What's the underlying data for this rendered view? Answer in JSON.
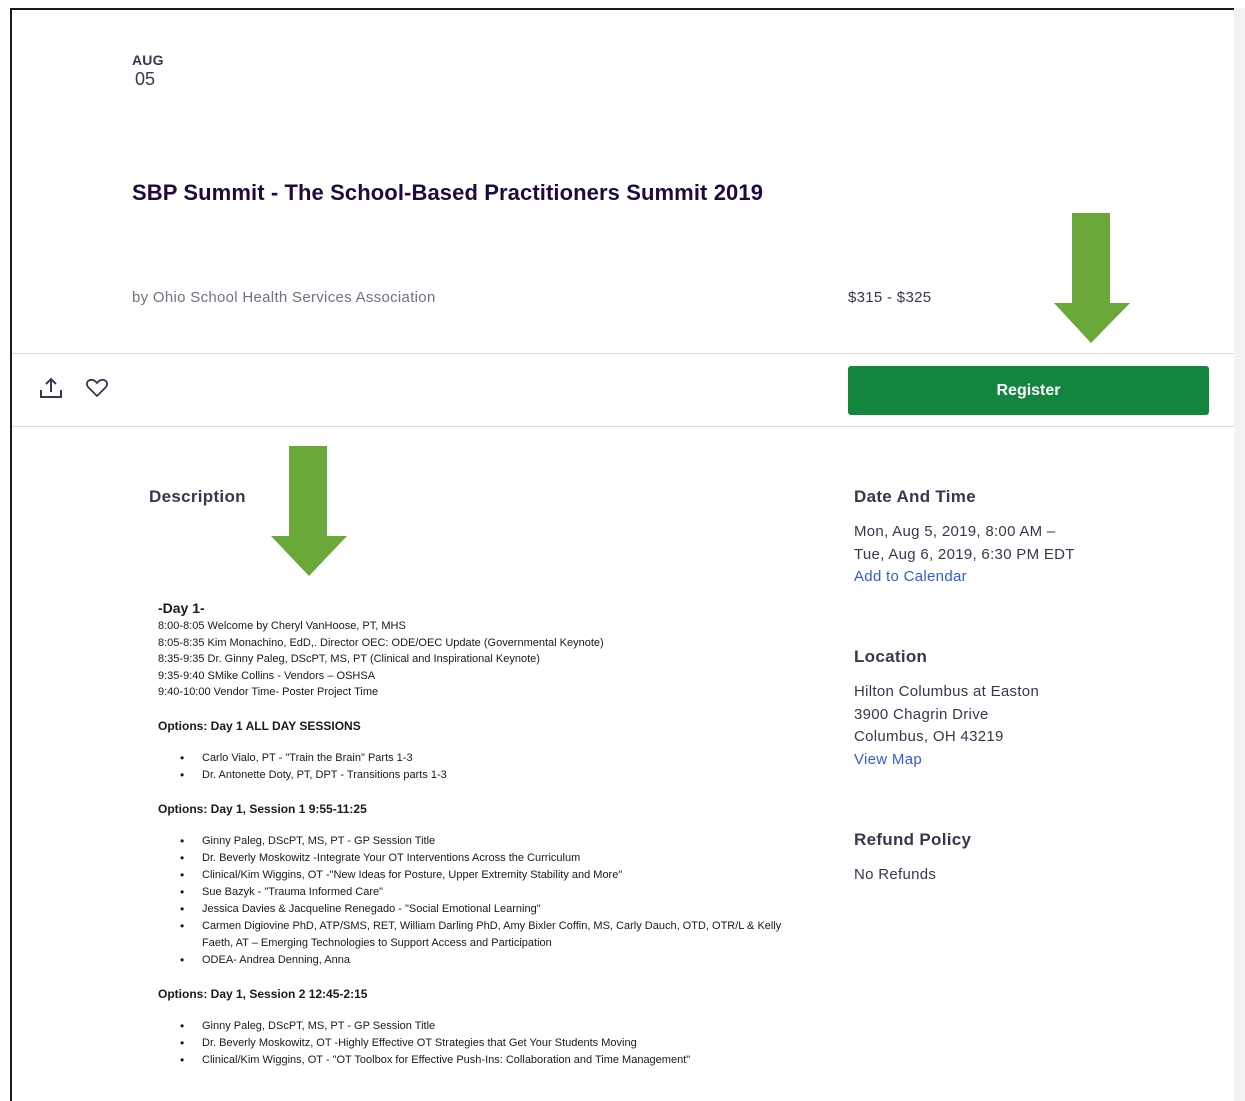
{
  "event": {
    "month": "AUG",
    "day": "05",
    "title": "SBP Summit - The School-Based Practitioners Summit 2019",
    "organizer": "by Ohio School Health Services Association",
    "price": "$315 - $325"
  },
  "actions": {
    "register_label": "Register",
    "share_icon": "share-icon",
    "like_icon": "heart-icon"
  },
  "description": {
    "heading": "Description",
    "day1_title": "-Day 1-",
    "schedule": [
      "8:00-8:05 Welcome by Cheryl VanHoose, PT, MHS",
      "8:05-8:35 Kim Monachino, EdD,. Director OEC: ODE/OEC Update (Governmental Keynote)",
      "8:35-9:35 Dr. Ginny Paleg, DScPT, MS, PT   (Clinical and Inspirational Keynote)",
      "9:35-9:40 SMike Collins - Vendors – OSHSA",
      "9:40-10:00 Vendor Time- Poster Project Time"
    ],
    "options": [
      {
        "title": "Options: Day 1 ALL DAY SESSIONS",
        "items": [
          "Carlo Vialo, PT - \"Train the Brain\" Parts 1-3",
          "Dr. Antonette Doty, PT, DPT - Transitions parts 1-3"
        ]
      },
      {
        "title": "Options: Day 1, Session 1 9:55-11:25",
        "items": [
          "Ginny Paleg, DScPT, MS, PT - GP Session Title",
          "Dr. Beverly  Moskowitz -Integrate Your OT Interventions Across the Curriculum",
          "Clinical/Kim Wiggins, OT -\"New Ideas for Posture, Upper Extremity Stability and More\"",
          "Sue Bazyk - \"Trauma Informed Care\"",
          "Jessica Davies & Jacqueline Renegado - \"Social Emotional Learning\"",
          "Carmen Digiovine PhD, ATP/SMS, RET, William Darling PhD, Amy Bixler Coffin, MS, Carly Dauch, OTD, OTR/L & Kelly Faeth, AT – Emerging Technologies to Support Access and Participation",
          "ODEA- Andrea Denning, Anna"
        ]
      },
      {
        "title": "Options: Day 1, Session 2 12:45-2:15",
        "items": [
          "Ginny Paleg, DScPT, MS, PT  - GP Session Title",
          "Dr. Beverly Moskowitz, OT -Highly Effective OT Strategies that Get Your Students Moving",
          "Clinical/Kim Wiggins, OT - \"OT Toolbox for Effective Push-Ins: Collaboration and Time Management\""
        ]
      }
    ]
  },
  "sidebar": {
    "date_time": {
      "heading": "Date And Time",
      "line1": "Mon, Aug 5, 2019, 8:00 AM –",
      "line2": "Tue, Aug 6, 2019, 6:30 PM EDT",
      "link": "Add to Calendar"
    },
    "location": {
      "heading": "Location",
      "line1": "Hilton Columbus at Easton",
      "line2": "3900 Chagrin Drive",
      "line3": "Columbus, OH 43219",
      "link": "View Map"
    },
    "refund": {
      "heading": "Refund Policy",
      "text": "No Refunds"
    }
  },
  "colors": {
    "register_bg": "#12863f",
    "arrow_fill": "#6aa83a",
    "link": "#3659e3",
    "title": "#1e0a3c"
  }
}
